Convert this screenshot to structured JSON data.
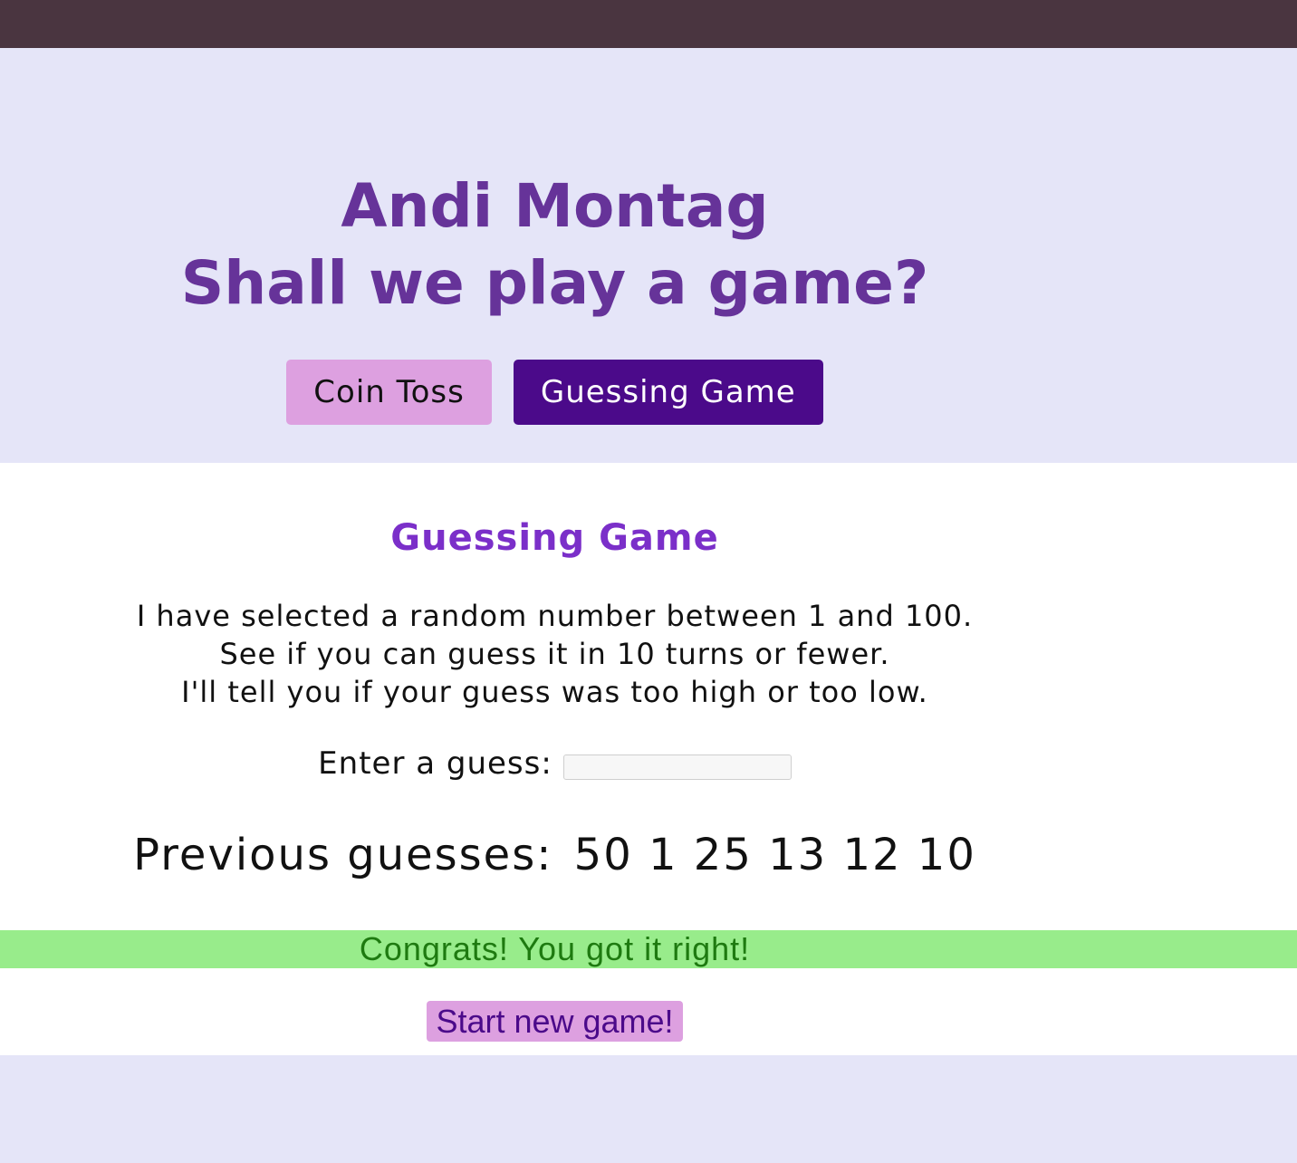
{
  "header": {
    "name": "Andi Montag",
    "tagline": "Shall we play a game?"
  },
  "nav": {
    "coin_toss": "Coin Toss",
    "guessing_game": "Guessing Game",
    "active": "guessing_game"
  },
  "game": {
    "heading": "Guessing Game",
    "instructions": [
      "I have selected a random number between 1 and 100.",
      "See if you can guess it in 10 turns or fewer.",
      "I'll tell you if your guess was too high or too low."
    ],
    "guess_label": "Enter a guess:",
    "guess_value": "",
    "previous_label": "Previous guesses:",
    "previous_guesses": "50 1 25 13 12 10",
    "result_message": "Congrats! You got it right!",
    "new_game_label": "Start new game!"
  },
  "colors": {
    "topbar": "#4a3540",
    "hero_bg": "#e5e5f8",
    "title": "#663399",
    "accent_dark": "#4b0a8a",
    "accent_light": "#dda0e0",
    "success_bg": "#98ec8b",
    "success_text": "#1e7a10"
  }
}
